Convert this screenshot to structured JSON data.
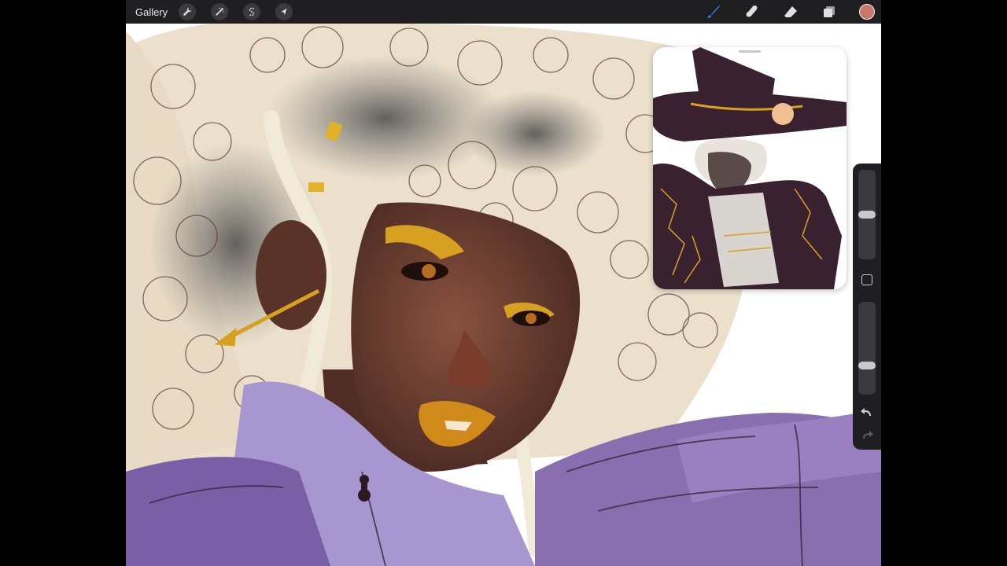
{
  "app": {
    "gallery_label": "Gallery",
    "left_tools": [
      {
        "name": "actions",
        "icon": "wrench-icon"
      },
      {
        "name": "adjustments",
        "icon": "magic-wand-icon"
      },
      {
        "name": "selection",
        "icon": "selection-s-icon"
      },
      {
        "name": "transform",
        "icon": "cursor-arrow-icon"
      }
    ],
    "right_tools": [
      {
        "name": "brush",
        "icon": "brush-icon",
        "active": true
      },
      {
        "name": "smudge",
        "icon": "smudge-finger-icon",
        "active": false
      },
      {
        "name": "eraser",
        "icon": "eraser-icon",
        "active": false
      },
      {
        "name": "layers",
        "icon": "layers-icon",
        "active": false
      }
    ],
    "current_color": "#c9786a",
    "active_tool_color": "#2f7fe0"
  },
  "sidebar": {
    "brush_size_level": 0.5,
    "opacity_level": 0.3,
    "modify_icon": "square-icon",
    "undo_icon": "undo-arrow-icon",
    "redo_icon": "redo-arrow-icon"
  },
  "colors": {
    "hair": "#ece0cc",
    "skin": "#6b3f32",
    "purple": "#8a6fb0",
    "gold": "#d8a020"
  }
}
